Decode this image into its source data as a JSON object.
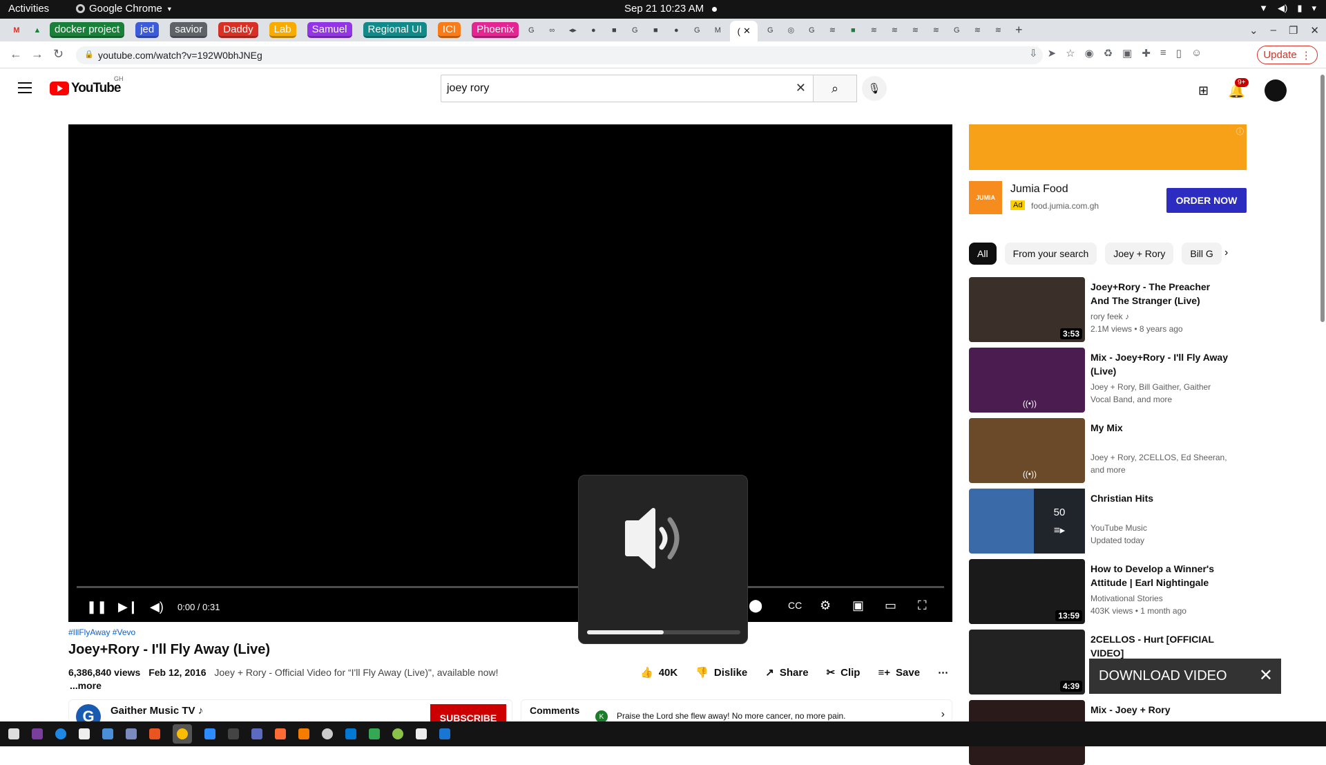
{
  "os": {
    "activities": "Activities",
    "app": "Google Chrome",
    "clock": "Sep 21  10:23 AM"
  },
  "tabs": {
    "groups": [
      {
        "label": "docker project",
        "color": "#188038"
      },
      {
        "label": "jed",
        "color": "#3b5bdb"
      },
      {
        "label": "savior",
        "color": "#5f6368"
      },
      {
        "label": "Daddy",
        "color": "#d93025"
      },
      {
        "label": "Lab",
        "color": "#f9ab00"
      },
      {
        "label": "Samuel",
        "color": "#9334e6"
      },
      {
        "label": "Regional UI",
        "color": "#128a8a"
      },
      {
        "label": "ICI",
        "color": "#fa7b17"
      },
      {
        "label": "Phoenix",
        "color": "#e52592"
      }
    ],
    "active_label": "(",
    "new_tab": "+"
  },
  "omnibox": {
    "url": "youtube.com/watch?v=192W0bhJNEg",
    "update_label": "Update"
  },
  "youtube": {
    "logo": "YouTube",
    "country": "GH",
    "search_value": "joey rory",
    "notif_count": "9+"
  },
  "player": {
    "time": "0:00 / 0:31",
    "volume_level": 0.5
  },
  "video": {
    "tags": "#IllFlyAway #Vevo",
    "title": "Joey+Rory - I'll Fly Away (Live)",
    "views": "6,386,840 views",
    "date": "Feb 12, 2016",
    "description": "Joey + Rory - Official Video for “I'll Fly Away (Live)\", available now!",
    "more": "...more",
    "likes": "40K",
    "dislike": "Dislike",
    "share": "Share",
    "clip": "Clip",
    "save": "Save"
  },
  "channel": {
    "name": "Gaither Music TV",
    "subscribe": "SUBSCRIBE"
  },
  "comments": {
    "label": "Comments",
    "avatar": "K",
    "text": "Praise the Lord she flew away! No more cancer, no more pain."
  },
  "ad": {
    "name": "Jumia Food",
    "badge": "Ad",
    "domain": "food.jumia.com.gh",
    "cta": "ORDER NOW",
    "logo": "JUMIA"
  },
  "chips": [
    "All",
    "From your search",
    "Joey + Rory",
    "Bill G"
  ],
  "recs": [
    {
      "title": "Joey+Rory - The Preacher And The Stranger (Live)",
      "line1": "rory feek ♪",
      "line2": "2.1M views • 8 years ago",
      "duration": "3:53"
    },
    {
      "title": "Mix - Joey+Rory - I'll Fly Away (Live)",
      "line1": "Joey + Rory, Bill Gaither, Gaither Vocal Band, and more",
      "line2": "",
      "duration": "((•))"
    },
    {
      "title": "My Mix",
      "line1": "Joey + Rory, 2CELLOS, Ed Sheeran, and more",
      "line2": "",
      "duration": "((•))"
    },
    {
      "title": "Christian Hits",
      "line1": "YouTube Music",
      "line2": "Updated today",
      "duration": "50"
    },
    {
      "title": "How to Develop a Winner's Attitude | Earl Nightingale",
      "line1": "Motivational Stories",
      "line2": "403K views • 1 month ago",
      "duration": "13:59"
    },
    {
      "title": "2CELLOS - Hurt [OFFICIAL VIDEO]",
      "line1": "",
      "line2": "",
      "duration": "4:39"
    },
    {
      "title": "Mix - Joey + Rory",
      "line1": "",
      "line2": "",
      "duration": ""
    }
  ],
  "download": {
    "label": "DOWNLOAD VIDEO"
  }
}
